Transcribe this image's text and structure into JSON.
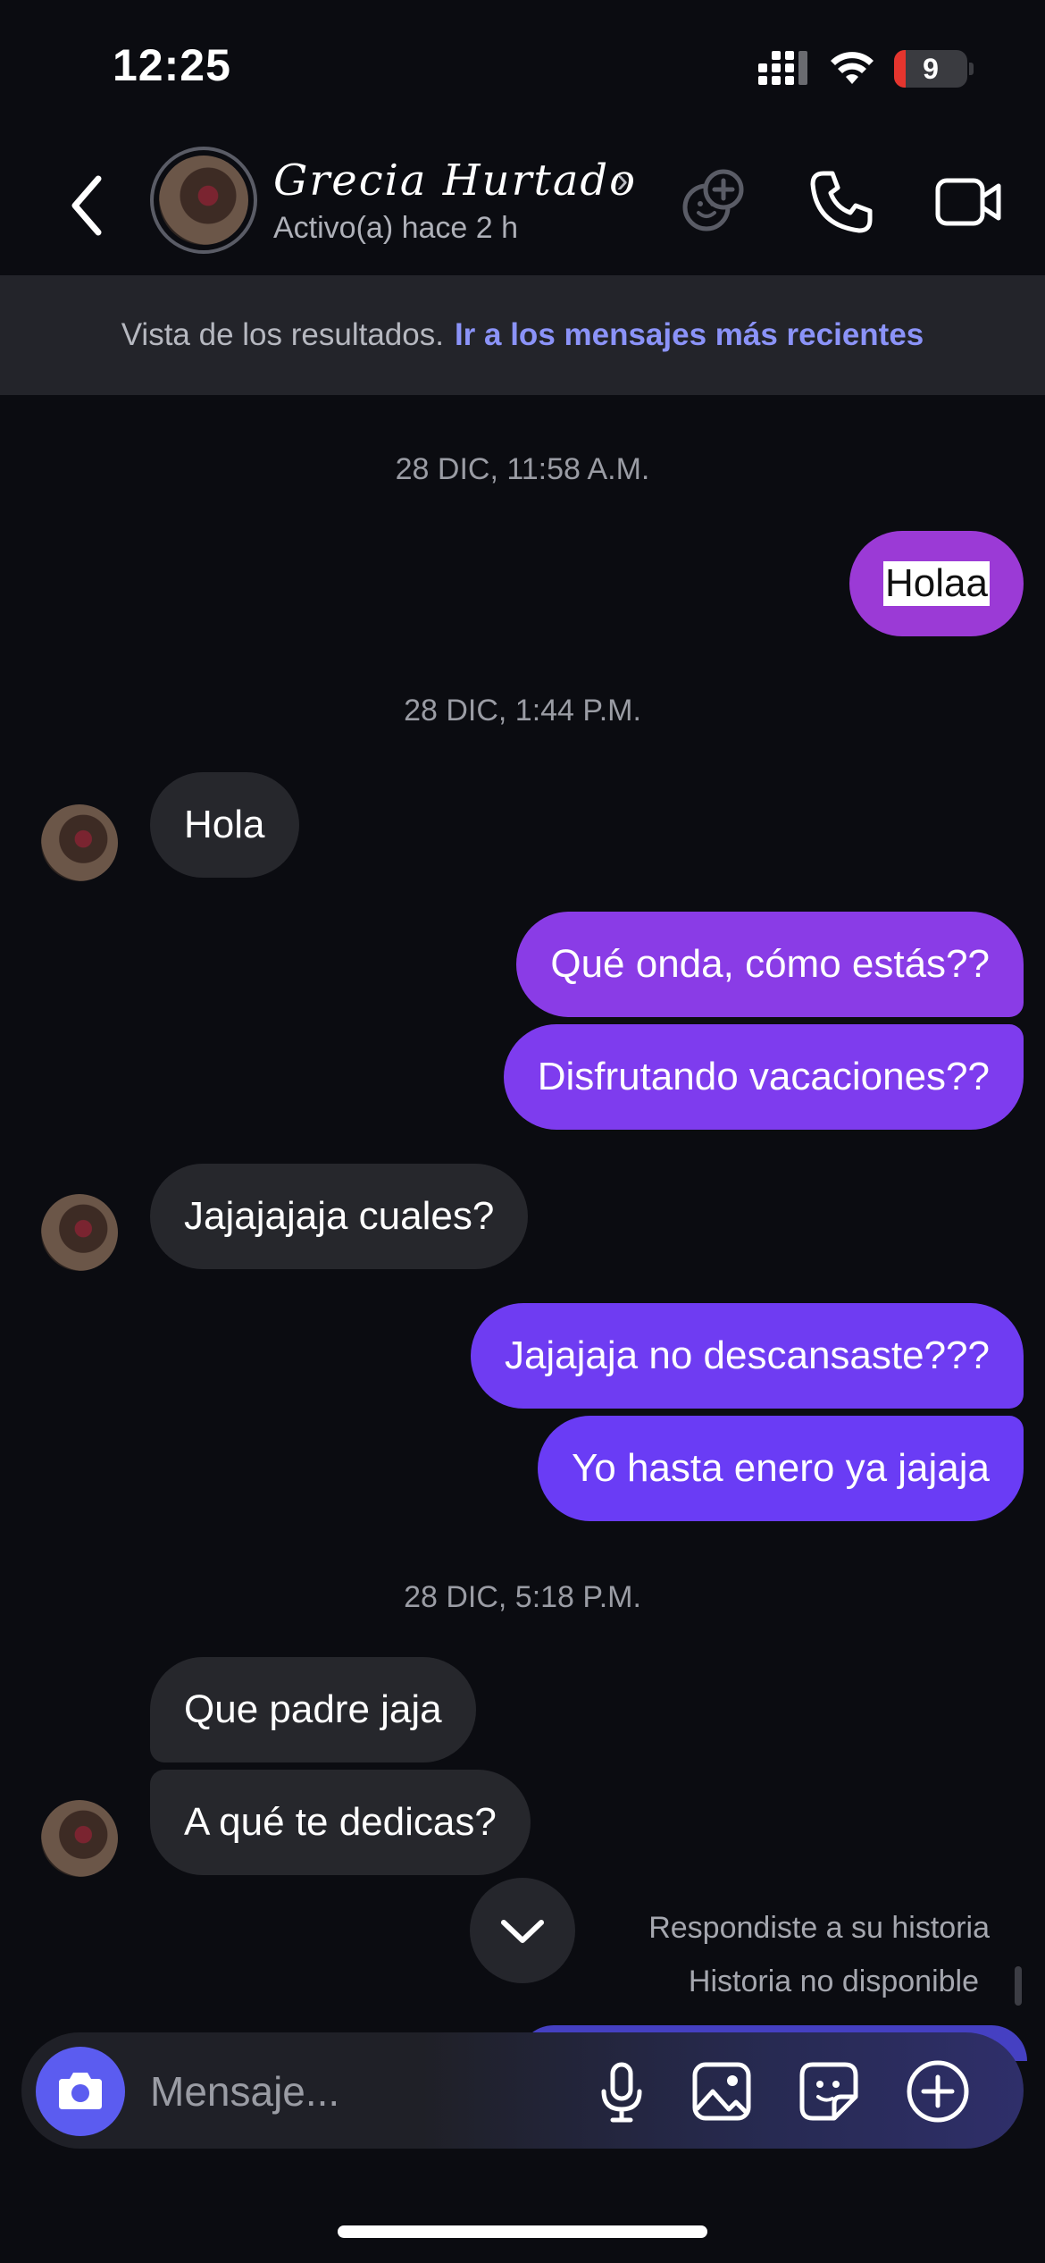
{
  "status_bar": {
    "time": "12:25",
    "battery_level": "9",
    "icons": [
      "cellular-signal-icon",
      "wifi-icon",
      "battery-icon"
    ]
  },
  "header": {
    "contact_name": "Grecia Hurtado",
    "status": "Activo(a) hace 2 h",
    "icons": [
      "back-chevron-icon",
      "chevron-right-icon",
      "add-people-icon",
      "phone-icon",
      "video-camera-icon"
    ]
  },
  "banner": {
    "text": "Vista de los resultados.",
    "link": "Ir a los mensajes más recientes"
  },
  "timestamps": [
    "28 DIC, 11:58 A.M.",
    "28 DIC, 1:44 P.M.",
    "28 DIC, 5:18 P.M."
  ],
  "messages": [
    {
      "from": "me",
      "text": "Holaa",
      "highlighted": true
    },
    {
      "from": "them",
      "text": "Hola"
    },
    {
      "from": "me",
      "text": "Qué onda, cómo estás??"
    },
    {
      "from": "me",
      "text": "Disfrutando vacaciones??"
    },
    {
      "from": "them",
      "text": "Jajajajaja cuales?"
    },
    {
      "from": "me",
      "text": "Jajajaja no descansaste???"
    },
    {
      "from": "me",
      "text": "Yo hasta enero ya jajaja"
    },
    {
      "from": "them",
      "text": "Que padre jaja"
    },
    {
      "from": "them",
      "text": "A qué te dedicas?"
    }
  ],
  "story_reply": {
    "title": "Respondiste a su historia",
    "subtitle": "Historia no disponible"
  },
  "composer": {
    "placeholder": "Mensaje...",
    "icons": [
      "camera-icon",
      "microphone-icon",
      "gallery-icon",
      "sticker-icon",
      "plus-circle-icon"
    ]
  },
  "colors": {
    "background": "#0b0c11",
    "incoming": "#26272c",
    "outgoing_top": "#9b3ad6",
    "outgoing_bottom": "#6a3cf5",
    "accent_link": "#8b93f8",
    "camera_button": "#5b5cf0"
  }
}
